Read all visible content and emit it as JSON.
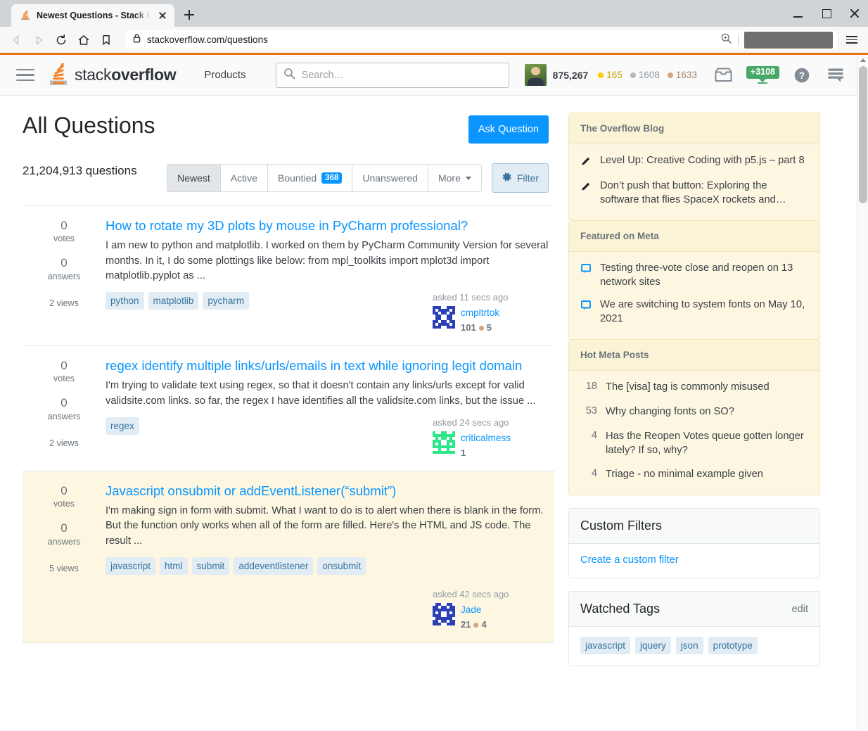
{
  "browser": {
    "tab_title": "Newest Questions - Stack Ove",
    "tab_favicon_name": "stackoverflow-favicon",
    "new_tab_label": "+",
    "url": "stackoverflow.com/questions",
    "nav": {
      "back": "back-arrow",
      "forward": "forward-arrow",
      "reload": "reload",
      "home": "home",
      "bookmark": "bookmark"
    },
    "window_controls": {
      "minimize": "minimize",
      "maximize": "maximize",
      "close": "close"
    }
  },
  "topbar": {
    "menu_label": "menu",
    "logo_stack": "stack",
    "logo_overflow": "overflow",
    "products_label": "Products",
    "search_placeholder": "Search…",
    "search_value": "",
    "reputation": "875,267",
    "badges": {
      "gold": "165",
      "silver": "1608",
      "bronze": "1633"
    },
    "achievements_badge": "+3108",
    "icons": {
      "inbox": "inbox-icon",
      "achievements": "achievements-icon",
      "help": "help-icon",
      "site_switcher": "site-switcher-icon"
    },
    "colors": {
      "accent": "#f48024",
      "link": "#0a95ff"
    }
  },
  "main": {
    "title": "All Questions",
    "ask_button": "Ask Question",
    "question_count": "21,204,913 questions",
    "tabs": [
      {
        "label": "Newest",
        "active": true,
        "pill": ""
      },
      {
        "label": "Active",
        "active": false,
        "pill": ""
      },
      {
        "label": "Bountied",
        "active": false,
        "pill": "368"
      },
      {
        "label": "Unanswered",
        "active": false,
        "pill": ""
      },
      {
        "label": "More",
        "active": false,
        "pill": "",
        "caret": true
      }
    ],
    "filter_button": "Filter",
    "questions": [
      {
        "votes": "0",
        "votes_label": "votes",
        "answers": "0",
        "answers_label": "answers",
        "views": "2 views",
        "title": "How to rotate my 3D plots by mouse in PyCharm professional?",
        "excerpt": "I am new to python and matplotlib. I worked on them by PyCharm Community Version for several months. In it, I do some plottings like below: from mpl_toolkits import mplot3d import matplotlib.pyplot as ...",
        "tags": [
          "python",
          "matplotlib",
          "pycharm"
        ],
        "asked": "asked 11 secs ago",
        "user": "cmpltrtok",
        "user_rep": "101",
        "user_bronze": "5",
        "highlight": false
      },
      {
        "votes": "0",
        "votes_label": "votes",
        "answers": "0",
        "answers_label": "answers",
        "views": "2 views",
        "title": "regex identify multiple links/urls/emails in text while ignoring legit domain",
        "excerpt": "I'm trying to validate text using regex, so that it doesn't contain any links/urls except for valid validsite.com links. so far, the regex I have identifies all the validsite.com links, but the issue ...",
        "tags": [
          "regex"
        ],
        "asked": "asked 24 secs ago",
        "user": "criticalmess",
        "user_rep": "1",
        "user_bronze": "",
        "highlight": false
      },
      {
        "votes": "0",
        "votes_label": "votes",
        "answers": "0",
        "answers_label": "answers",
        "views": "5 views",
        "title": "Javascript onsubmit or addEventListener(“submit”)",
        "excerpt": "I'm making sign in form with submit. What I want to do is to alert when there is blank in the form. But the function only works when all of the form are filled. Here's the HTML and JS code. The result ...",
        "tags": [
          "javascript",
          "html",
          "submit",
          "addeventlistener",
          "onsubmit"
        ],
        "asked": "asked 42 secs ago",
        "user": "Jade",
        "user_rep": "21",
        "user_bronze": "4",
        "highlight": true
      }
    ]
  },
  "sidebar": {
    "blog": {
      "heading": "The Overflow Blog",
      "items": [
        "Level Up: Creative Coding with p5.js – part 8",
        "Don’t push that button: Exploring the software that flies SpaceX rockets and…"
      ]
    },
    "meta": {
      "heading": "Featured on Meta",
      "items": [
        "Testing three-vote close and reopen on 13 network sites",
        "We are switching to system fonts on May 10, 2021"
      ]
    },
    "hot": {
      "heading": "Hot Meta Posts",
      "items": [
        {
          "votes": "18",
          "text": "The [visa] tag is commonly misused"
        },
        {
          "votes": "53",
          "text": "Why changing fonts on SO?"
        },
        {
          "votes": "4",
          "text": "Has the Reopen Votes queue gotten longer lately? If so, why?"
        },
        {
          "votes": "4",
          "text": "Triage - no minimal example given"
        }
      ]
    },
    "custom_filters": {
      "heading": "Custom Filters",
      "link": "Create a custom filter"
    },
    "watched_tags": {
      "heading": "Watched Tags",
      "edit": "edit",
      "tags": [
        "javascript",
        "jquery",
        "json",
        "prototype"
      ]
    }
  }
}
